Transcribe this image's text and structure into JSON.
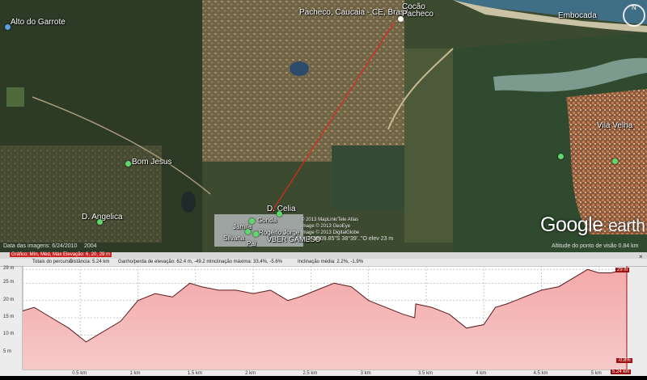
{
  "map": {
    "places": [
      {
        "id": "alto-do-garrote",
        "text": "Alto do Garrote"
      },
      {
        "id": "pacheco-caucaia",
        "text": "Pacheco, Caucaia - CE, Brasil"
      },
      {
        "id": "cocao-pacheco",
        "text": "Cocão Pacheco"
      },
      {
        "id": "embocada",
        "text": "Embocada"
      },
      {
        "id": "bom-jesus",
        "text": "Bom Jesus"
      },
      {
        "id": "d-angelica",
        "text": "D. Angelica"
      },
      {
        "id": "d-celia",
        "text": "D. Celia"
      },
      {
        "id": "vila-velha",
        "text": "Vila Velha"
      },
      {
        "id": "jamila",
        "text": "Jamila"
      },
      {
        "id": "rogerio",
        "text": "Rogério Jorge"
      },
      {
        "id": "silvana",
        "text": "Silvana"
      },
      {
        "id": "gonda",
        "text": "Gonda"
      },
      {
        "id": "pai",
        "text": "Pai"
      },
      {
        "id": "gameso",
        "text": "VBER GAMESO"
      }
    ],
    "logo_main": "Google",
    "logo_sub": "earth",
    "compass_label": "N",
    "copyright_lines": [
      "© 2013 MapLink/Tele Atlas",
      "Image © 2013 GeoEye",
      "Image © 2013 DigitalGlobe"
    ],
    "pointer_readout": "3°38'09.85\"S  38°39'..\"O elev  23 m",
    "status_left": "Data das imagens: 6/24/2010",
    "status_year": "2004",
    "status_right": "Altitude do ponto de visão  0.84 km"
  },
  "profile": {
    "toolbar": {
      "graph_label": "Gráfico: Mín, Méd, Máx Elevação: 6, 20, 29 m"
    },
    "stats": {
      "totals": "Totais do percurso",
      "distance": "Distância: 5.24 km",
      "gain_loss": "Ganho/perda de elevação: 62.4 m, -49.2 m",
      "max_slope": "Inclinação máxima: 33.4%, -5.6%",
      "avg_slope": "Inclinação média: 2.2%, -1.9%"
    },
    "close_icon": "×",
    "current_value_tag": "29 m",
    "current_slope_tag": "-0.8%",
    "end_distance_tag": "5.24 km"
  },
  "chart_data": {
    "type": "area",
    "title": "",
    "xlabel": "",
    "ylabel": "",
    "ylim": [
      0,
      30
    ],
    "xlim": [
      0,
      5.24
    ],
    "y_ticks": [
      "29 m",
      "25 m",
      "20 m",
      "15 m",
      "10 m",
      "5 m"
    ],
    "y_tick_values": [
      29,
      25,
      20,
      15,
      10,
      5
    ],
    "x_ticks": [
      "0.5 km",
      "1 km",
      "1.5 km",
      "2 km",
      "2.5 km",
      "3 km",
      "3.5 km",
      "4 km",
      "4.5 km",
      "5 km"
    ],
    "x_tick_values": [
      0.5,
      1,
      1.5,
      2,
      2.5,
      3,
      3.5,
      4,
      4.5,
      5
    ],
    "colors": {
      "fill": "#f6c9c9",
      "fill_top": "#f4a9a9",
      "line": "#5a1c1c",
      "grid": "#c8c8c8"
    },
    "x": [
      0.0,
      0.1,
      0.25,
      0.4,
      0.55,
      0.65,
      0.85,
      1.0,
      1.15,
      1.3,
      1.45,
      1.55,
      1.7,
      1.85,
      2.0,
      2.15,
      2.3,
      2.4,
      2.55,
      2.7,
      2.85,
      3.0,
      3.15,
      3.3,
      3.4,
      3.41,
      3.55,
      3.7,
      3.85,
      4.0,
      4.1,
      4.2,
      4.35,
      4.5,
      4.65,
      4.8,
      4.9,
      5.0,
      5.1,
      5.24
    ],
    "values": [
      17,
      18,
      15,
      12,
      8,
      10,
      14,
      20,
      22,
      21,
      25,
      24,
      23,
      23,
      22,
      23,
      20,
      21,
      23,
      25,
      24,
      20,
      18,
      16,
      15,
      19,
      18,
      16,
      12,
      13,
      18,
      19,
      21,
      23,
      24,
      27,
      29,
      28,
      28,
      29
    ]
  }
}
